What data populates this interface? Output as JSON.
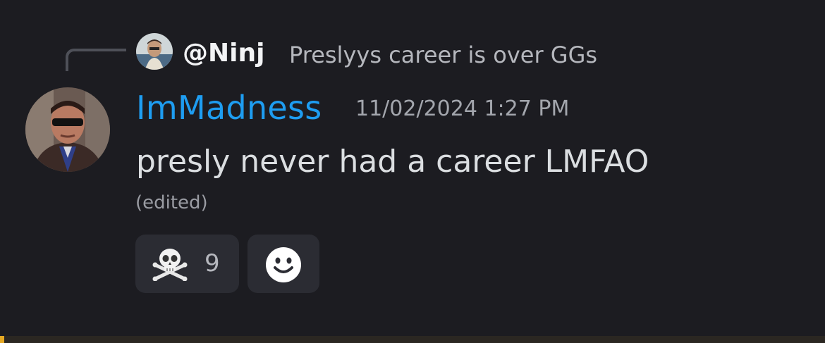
{
  "reply": {
    "username": "@Ninj",
    "preview": "Preslyys career is over GGs"
  },
  "message": {
    "author": "ImMadness",
    "author_color": "#1e9df1",
    "timestamp": "11/02/2024 1:27 PM",
    "text": "presly never had a career LMFAO",
    "edited_label": "(edited)"
  },
  "reactions": [
    {
      "icon": "skull-and-crossbones-icon",
      "count": "9"
    }
  ],
  "add_reaction_icon": "smiley-face-icon",
  "colors": {
    "background": "#1c1c21",
    "reaction_bg": "#2b2c33",
    "accent_bar": "#e5a823"
  }
}
